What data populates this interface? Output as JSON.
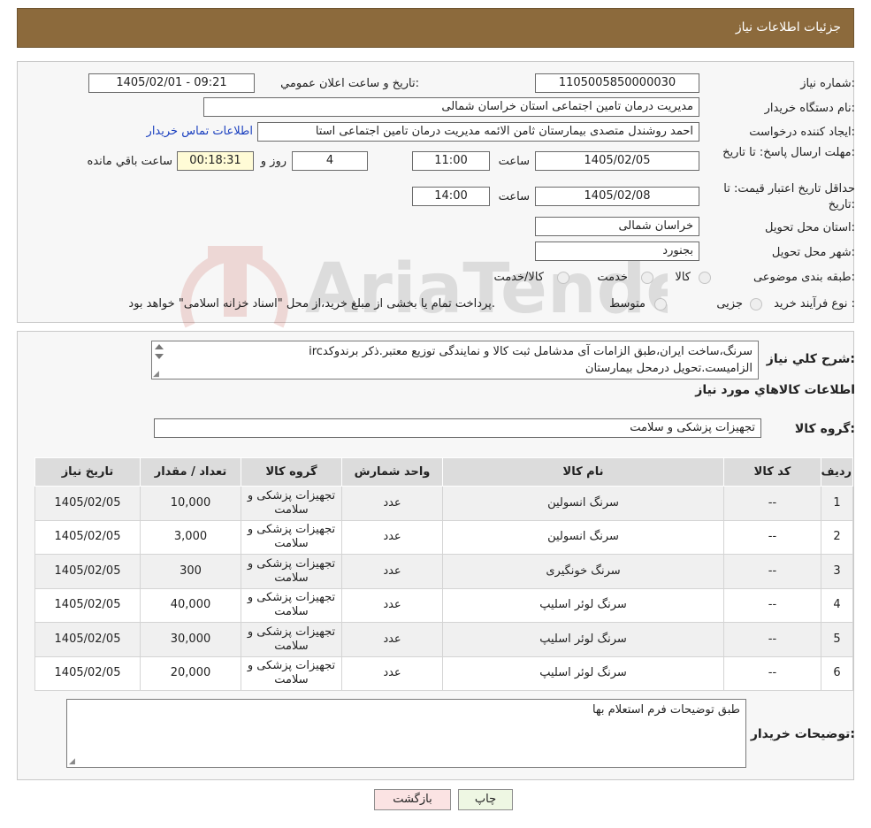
{
  "header": {
    "title": "جزئیات اطلاعات نیاز"
  },
  "watermark": {
    "brand": "AriaTender.neT"
  },
  "form": {
    "need_number_label": "شماره نیاز:",
    "need_number": "1105005850000030",
    "announce_label": "تاریخ و ساعت اعلان عمومي:",
    "announce_value": "1405/02/01 - 09:21",
    "buyer_label": "نام دستگاه خریدار:",
    "buyer_value": "مدیریت درمان تامین اجتماعی استان خراسان شمالی",
    "creator_label": "ایجاد کننده درخواست:",
    "creator_value": "احمد روشندل متصدی بیمارستان ثامن الائمه مدیریت درمان تامین اجتماعی استا",
    "contact_link": "اطلاعات تماس خریدار",
    "reply_label": "مهلت ارسال پاسخ: تا تاریخ:",
    "reply_date": "1405/02/05",
    "time_label": "ساعت",
    "reply_time": "11:00",
    "days_value": "4",
    "days_label": "روز و",
    "remaining_value": "00:18:31",
    "remaining_label": "ساعت باقي مانده",
    "validity_label": "حداقل تاریخ اعتبار قیمت: تا تاریخ:",
    "validity_date": "1405/02/08",
    "validity_time": "14:00",
    "province_label": "استان محل تحویل:",
    "province_value": "خراسان شمالی",
    "city_label": "شهر محل تحویل:",
    "city_value": "بجنورد",
    "category_label": "طبقه بندی موضوعی:",
    "category_options": [
      "کالا",
      "خدمت",
      "کالا/خدمت"
    ],
    "process_label": "نوع فرآیند خرید :",
    "process_options": [
      "جزیی",
      "متوسط"
    ],
    "process_note": "پرداخت تمام یا بخشی از مبلغ خرید،از محل \"اسناد خزانه اسلامی\" خواهد بود."
  },
  "description": {
    "label": "شرح کلي نیاز:",
    "line1": "سرنگ،ساخت ایران،طبق الزامات آی مدشامل ثبت کالا و نمایندگی توزیع معتبر.ذکر برندوکدirc",
    "line2": "الزامیست.تحویل درمحل بیمارستان"
  },
  "goods": {
    "section_title": "اطلاعات کالاهاي مورد نیاز",
    "group_label": "گروه کالا:",
    "group_value": "تجهیزات پزشکی و سلامت",
    "columns": [
      "ردیف",
      "کد کالا",
      "نام کالا",
      "واحد شمارش",
      "گروه کالا",
      "تعداد / مقدار",
      "تاریخ نیاز"
    ],
    "rows": [
      {
        "idx": "1",
        "code": "--",
        "name": "سرنگ انسولین",
        "unit": "عدد",
        "group": "تجهیزات پزشکی و سلامت",
        "qty": "10,000",
        "date": "1405/02/05"
      },
      {
        "idx": "2",
        "code": "--",
        "name": "سرنگ انسولین",
        "unit": "عدد",
        "group": "تجهیزات پزشکی و سلامت",
        "qty": "3,000",
        "date": "1405/02/05"
      },
      {
        "idx": "3",
        "code": "--",
        "name": "سرنگ خونگیری",
        "unit": "عدد",
        "group": "تجهیزات پزشکی و سلامت",
        "qty": "300",
        "date": "1405/02/05"
      },
      {
        "idx": "4",
        "code": "--",
        "name": "سرنگ لوئر اسلیپ",
        "unit": "عدد",
        "group": "تجهیزات پزشکی و سلامت",
        "qty": "40,000",
        "date": "1405/02/05"
      },
      {
        "idx": "5",
        "code": "--",
        "name": "سرنگ لوئر اسلیپ",
        "unit": "عدد",
        "group": "تجهیزات پزشکی و سلامت",
        "qty": "30,000",
        "date": "1405/02/05"
      },
      {
        "idx": "6",
        "code": "--",
        "name": "سرنگ لوئر اسلیپ",
        "unit": "عدد",
        "group": "تجهیزات پزشکی و سلامت",
        "qty": "20,000",
        "date": "1405/02/05"
      }
    ]
  },
  "buyer_notes": {
    "label": "توضیحات خریدار:",
    "value": "طبق توضیحات فرم استعلام بها"
  },
  "buttons": {
    "print": "چاپ",
    "back": "بازگشت"
  },
  "colors": {
    "header_bg": "#8c6a3c",
    "back_button_bg": "#fbe3e3",
    "print_button_bg": "#eef7e3",
    "link": "#1a3fbf"
  }
}
